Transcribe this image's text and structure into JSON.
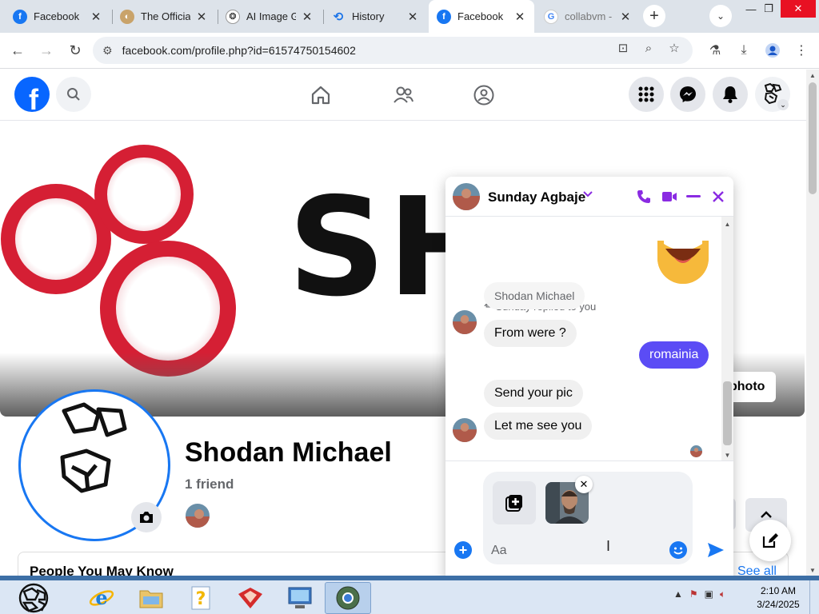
{
  "browser": {
    "tabs": [
      {
        "title": "Facebook",
        "icon": "facebook-icon",
        "active": false
      },
      {
        "title": "The Official",
        "icon": "site-icon",
        "active": false
      },
      {
        "title": "AI Image G",
        "icon": "ai-icon",
        "active": false
      },
      {
        "title": "History",
        "icon": "history-icon",
        "active": false
      },
      {
        "title": "Facebook",
        "icon": "facebook-icon",
        "active": true
      },
      {
        "title": "collabvm -",
        "icon": "google-icon",
        "active": false
      }
    ],
    "url": "facebook.com/profile.php?id=61574750154602"
  },
  "cover": {
    "text": "SH     N",
    "edit_label": "photo"
  },
  "profile": {
    "name": "Shodan Michael",
    "friends": "1 friend",
    "pymk_title": "People You May Know",
    "see_all": "See all"
  },
  "chat": {
    "contact_name": "Sunday Agbaje",
    "reply_note": "Sunday replied to you",
    "sender_label": "Shodan Michael",
    "messages": [
      {
        "text": "From were ?",
        "from": "them"
      },
      {
        "text": "romainia",
        "from": "me"
      },
      {
        "text": "Send your pic",
        "from": "them"
      },
      {
        "text": "Let me see you",
        "from": "them"
      }
    ],
    "input_placeholder": "Aa",
    "accent_color": "#8a2be2",
    "my_bubble_color": "#5b4cf5"
  },
  "taskbar": {
    "time": "2:10 AM",
    "date": "3/24/2025"
  }
}
